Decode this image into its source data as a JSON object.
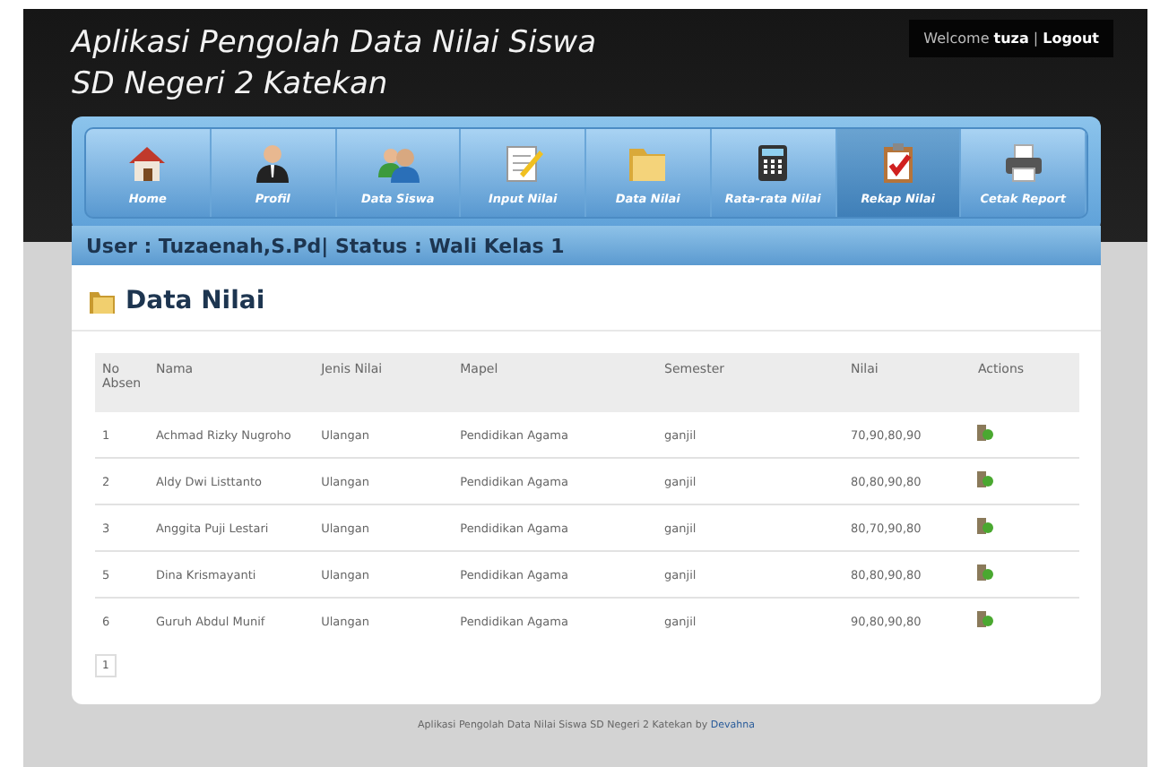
{
  "header": {
    "title_lines": [
      "Aplikasi Pengolah Data Nilai Siswa",
      "SD Negeri 2 Katekan"
    ],
    "welcome": "Welcome",
    "username": "tuza",
    "separator": "|",
    "logout": "Logout"
  },
  "nav": [
    {
      "kind": "home",
      "label": "Home",
      "selected": false
    },
    {
      "kind": "person",
      "label": "Profil",
      "selected": false
    },
    {
      "kind": "people",
      "label": "Data Siswa",
      "selected": false
    },
    {
      "kind": "document",
      "label": "Input Nilai",
      "selected": false
    },
    {
      "kind": "folder",
      "label": "Data Nilai",
      "selected": false
    },
    {
      "kind": "calculator",
      "label": "Rata-rata Nilai",
      "selected": false
    },
    {
      "kind": "clipboard",
      "label": "Rekap Nilai",
      "selected": true
    },
    {
      "kind": "printer",
      "label": "Cetak Report",
      "selected": false
    }
  ],
  "user_bar": "User : Tuzaenah,S.Pd| Status : Wali Kelas 1",
  "panel_title": "Data Nilai",
  "table": {
    "columns": [
      "No Absen",
      "Nama",
      "Jenis Nilai",
      "Mapel",
      "Semester",
      "Nilai",
      "Actions"
    ],
    "rows": [
      {
        "no": "1",
        "nama": "Achmad Rizky Nugroho",
        "jenis": "Ulangan",
        "mapel": "Pendidikan Agama",
        "semester": "ganjil",
        "nilai": "70,90,80,90"
      },
      {
        "no": "2",
        "nama": "Aldy Dwi Listtanto",
        "jenis": "Ulangan",
        "mapel": "Pendidikan Agama",
        "semester": "ganjil",
        "nilai": "80,80,90,80"
      },
      {
        "no": "3",
        "nama": "Anggita Puji Lestari",
        "jenis": "Ulangan",
        "mapel": "Pendidikan Agama",
        "semester": "ganjil",
        "nilai": "80,70,90,80"
      },
      {
        "no": "5",
        "nama": "Dina Krismayanti",
        "jenis": "Ulangan",
        "mapel": "Pendidikan Agama",
        "semester": "ganjil",
        "nilai": "80,80,90,80"
      },
      {
        "no": "6",
        "nama": "Guruh Abdul Munif",
        "jenis": "Ulangan",
        "mapel": "Pendidikan Agama",
        "semester": "ganjil",
        "nilai": "90,80,90,80"
      }
    ]
  },
  "pagination": [
    "1"
  ],
  "footer": {
    "text": "Aplikasi Pengolah Data Nilai Siswa SD Negeri 2 Katekan by",
    "link": "Devahna"
  }
}
